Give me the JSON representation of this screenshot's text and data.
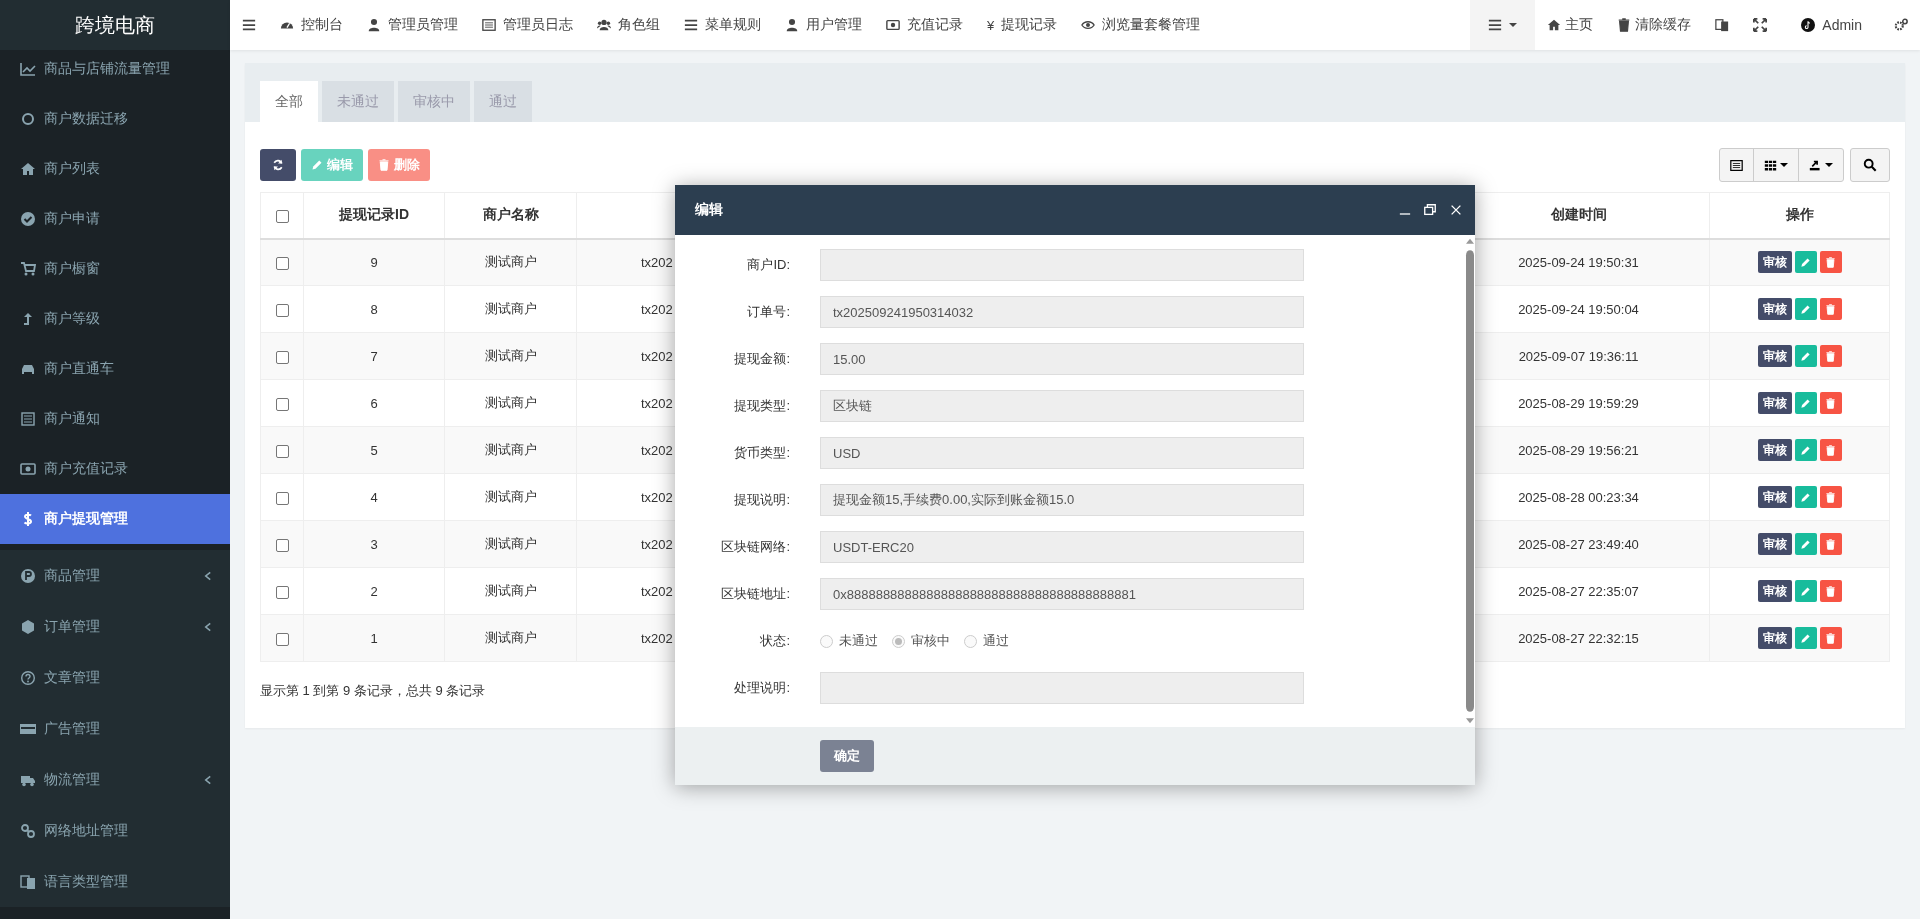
{
  "sidebar": {
    "title": "跨境电商",
    "items": [
      {
        "label": "商品与店铺流量管理",
        "selected": false,
        "expandable": false
      },
      {
        "label": "商户数据迁移",
        "selected": false,
        "expandable": false
      },
      {
        "label": "商户列表",
        "selected": false,
        "expandable": false
      },
      {
        "label": "商户申请",
        "selected": false,
        "expandable": false
      },
      {
        "label": "商户橱窗",
        "selected": false,
        "expandable": false
      },
      {
        "label": "商户等级",
        "selected": false,
        "expandable": false
      },
      {
        "label": "商户直通车",
        "selected": false,
        "expandable": false
      },
      {
        "label": "商户通知",
        "selected": false,
        "expandable": false
      },
      {
        "label": "商户充值记录",
        "selected": false,
        "expandable": false
      },
      {
        "label": "商户提现管理",
        "selected": true,
        "expandable": false
      },
      {
        "label": "商品管理",
        "selected": false,
        "expandable": true
      },
      {
        "label": "订单管理",
        "selected": false,
        "expandable": true
      },
      {
        "label": "文章管理",
        "selected": false,
        "expandable": false
      },
      {
        "label": "广告管理",
        "selected": false,
        "expandable": false
      },
      {
        "label": "物流管理",
        "selected": false,
        "expandable": true
      },
      {
        "label": "网络地址管理",
        "selected": false,
        "expandable": false
      },
      {
        "label": "语言类型管理",
        "selected": false,
        "expandable": false
      }
    ]
  },
  "topbar": {
    "nav": [
      {
        "label": "控制台"
      },
      {
        "label": "管理员管理"
      },
      {
        "label": "管理员日志"
      },
      {
        "label": "角色组"
      },
      {
        "label": "菜单规则"
      },
      {
        "label": "用户管理"
      },
      {
        "label": "充值记录"
      },
      {
        "label": "提现记录",
        "glyph": "¥"
      },
      {
        "label": "浏览量套餐管理"
      }
    ],
    "links": [
      {
        "label": "主页"
      },
      {
        "label": "清除缓存"
      }
    ],
    "user": "Admin"
  },
  "tabs": [
    {
      "label": "全部",
      "selected": true
    },
    {
      "label": "未通过",
      "selected": false
    },
    {
      "label": "审核中",
      "selected": false
    },
    {
      "label": "通过",
      "selected": false
    }
  ],
  "toolbar": [
    {
      "kind": "refresh",
      "disabled": false
    },
    {
      "kind": "edit",
      "label": "编辑",
      "disabled": true
    },
    {
      "kind": "delete",
      "label": "删除",
      "disabled": true
    }
  ],
  "table": {
    "all_checked": false,
    "columns": [
      "提现记录ID",
      "商户名称",
      "创建时间",
      "操作"
    ],
    "rows": [
      {
        "checked": false,
        "id": "9",
        "merchant": "测试商户",
        "column_3": "tx202",
        "created": "2025-09-24 19:50:31",
        "action": "审核"
      },
      {
        "checked": false,
        "id": "8",
        "merchant": "测试商户",
        "column_3": "tx202",
        "created": "2025-09-24 19:50:04",
        "action": "审核"
      },
      {
        "checked": false,
        "id": "7",
        "merchant": "测试商户",
        "column_3": "tx202",
        "created": "2025-09-07 19:36:11",
        "action": "审核"
      },
      {
        "checked": false,
        "id": "6",
        "merchant": "测试商户",
        "column_3": "tx202",
        "created": "2025-08-29 19:59:29",
        "action": "审核"
      },
      {
        "checked": false,
        "id": "5",
        "merchant": "测试商户",
        "column_3": "tx202",
        "created": "2025-08-29 19:56:21",
        "action": "审核"
      },
      {
        "checked": false,
        "id": "4",
        "merchant": "测试商户",
        "column_3": "tx202",
        "created": "2025-08-28 00:23:34",
        "action": "审核"
      },
      {
        "checked": false,
        "id": "3",
        "merchant": "测试商户",
        "column_3": "tx202",
        "created": "2025-08-27 23:49:40",
        "action": "审核"
      },
      {
        "checked": false,
        "id": "2",
        "merchant": "测试商户",
        "column_3": "tx202",
        "created": "2025-08-27 22:35:07",
        "action": "审核"
      },
      {
        "checked": false,
        "id": "1",
        "merchant": "测试商户",
        "column_3": "tx202",
        "created": "2025-08-27 22:32:15",
        "action": "审核"
      }
    ]
  },
  "summary": "显示第 1 到第 9 条记录，总共 9 条记录",
  "dialog": {
    "title": "编辑",
    "fields": [
      {
        "kind": "text",
        "label": "商户ID:"
      },
      {
        "kind": "text",
        "label": "订单号:",
        "value": "tx202509241950314032"
      },
      {
        "kind": "text",
        "label": "提现金额:",
        "value": "15.00"
      },
      {
        "kind": "text",
        "label": "提现类型:",
        "value": "区块链"
      },
      {
        "kind": "text",
        "label": "货币类型:",
        "value": "USD"
      },
      {
        "kind": "text",
        "label": "提现说明:",
        "value": "提现金额15,手续费0.00,实际到账金额15.0"
      },
      {
        "kind": "text",
        "label": "区块链网络:",
        "value": "USDT-ERC20"
      },
      {
        "kind": "text",
        "label": "区块链地址:",
        "value": "0x8888888888888888888888888888888888888881"
      },
      {
        "kind": "radio",
        "label": "状态:",
        "options": [
          {
            "label": "未通过",
            "selected": false
          },
          {
            "label": "审核中",
            "selected": true
          },
          {
            "label": "通过",
            "selected": false
          }
        ]
      },
      {
        "kind": "text",
        "label": "处理说明:"
      }
    ],
    "confirm": "确定"
  }
}
